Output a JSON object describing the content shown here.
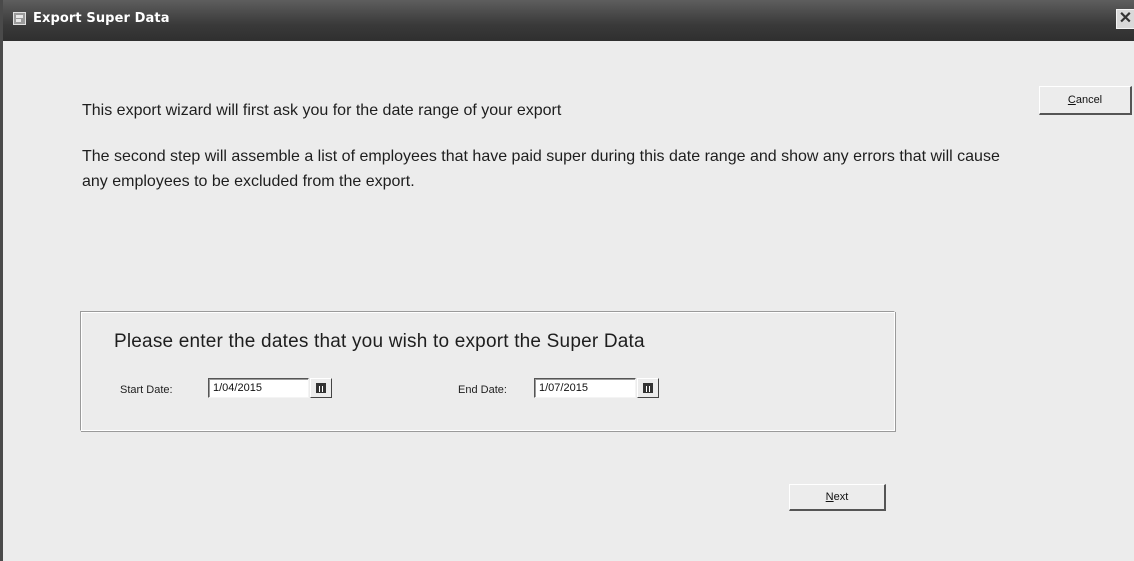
{
  "window": {
    "title": "Export Super Data",
    "close_symbol": "✕"
  },
  "intro": {
    "line1": "This export wizard will first ask you for the date range of your export",
    "line2": "The second step will assemble a list of employees that have paid super during this date range and show any errors that will cause any employees to be excluded from the export."
  },
  "buttons": {
    "cancel": {
      "accel": "C",
      "rest": "ancel"
    },
    "next": {
      "accel": "N",
      "rest": "ext"
    }
  },
  "dates": {
    "heading": "Please enter the dates that you wish to export the Super Data",
    "start_label": "Start Date:",
    "start_value": "1/04/2015",
    "end_label": "End Date:",
    "end_value": "1/07/2015"
  },
  "icons": {
    "window_icon": "app-icon",
    "calendar_icon": "calendar-icon"
  }
}
